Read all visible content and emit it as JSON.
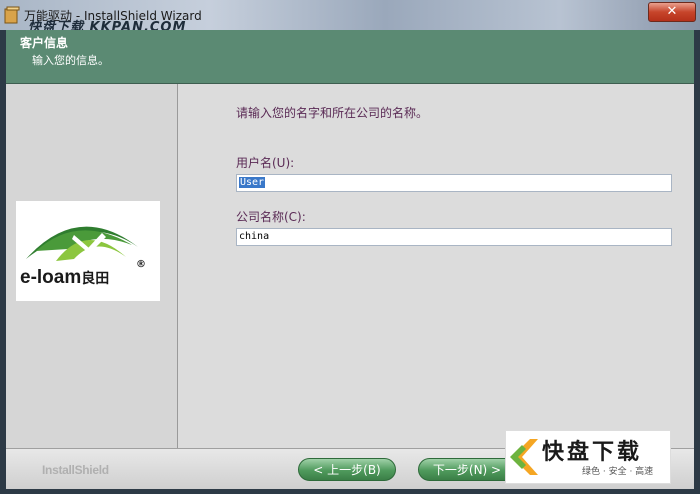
{
  "window": {
    "title": "万能驱动 - InstallShield Wizard",
    "close_label": "✕"
  },
  "watermark": {
    "top_text": "快盘下载 KKPAN.COM",
    "box_main": "快盘下载",
    "box_sub": "绿色 · 安全 · 高速"
  },
  "header": {
    "title": "客户信息",
    "subtitle": "输入您的信息。"
  },
  "logo": {
    "text": "e-loam",
    "text_cn": "良田",
    "mark": "®",
    "colors": {
      "dark_green": "#2f7d2f",
      "light_green": "#8cc63f"
    }
  },
  "form": {
    "prompt": "请输入您的名字和所在公司的名称。",
    "username_label": "用户名(U):",
    "username_value": "User",
    "company_label": "公司名称(C):",
    "company_value": "china"
  },
  "footer": {
    "brand": "InstallShield",
    "back_label": "< 上一步(B)",
    "next_label": "下一步(N) >"
  }
}
